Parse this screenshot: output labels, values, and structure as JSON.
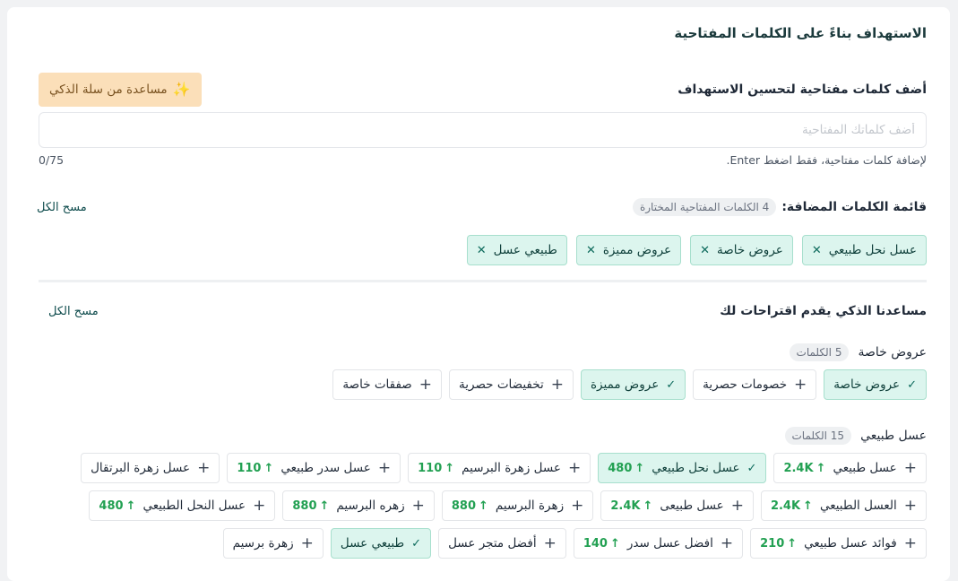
{
  "section_title": "الاستهداف بناءً على الكلمات المفتاحية",
  "keywords": {
    "label": "أضف كلمات مفتاحية لتحسين الاستهداف",
    "ai_button_label": "مساعدة من سلة الذكي",
    "ai_button_icon": "sparkles-icon",
    "input_placeholder": "أضف كلماتك المفتاحية",
    "input_value": "",
    "helper_text": "لإضافة كلمات مفتاحية، فقط اضغط Enter.",
    "char_counter": "0/75"
  },
  "added_list": {
    "label": "قائمة الكلمات المضافة:",
    "count_badge": "4 الكلمات المفتاحية المختارة",
    "clear_label": "مسح الكل",
    "chips": [
      {
        "label": "عسل نحل طبيعي"
      },
      {
        "label": "عروض خاصة"
      },
      {
        "label": "عروض مميزة"
      },
      {
        "label": "طبيعي عسل"
      }
    ]
  },
  "suggestions": {
    "label": "مساعدنا الذكي يقدم اقتراحات لك",
    "clear_label": "مسح الكل",
    "groups": [
      {
        "name": "عروض خاصة",
        "count_badge": "5 الكلمات",
        "chips": [
          {
            "label": "عروض خاصة",
            "selected": true,
            "stat": ""
          },
          {
            "label": "خصومات حصرية",
            "selected": false,
            "stat": ""
          },
          {
            "label": "عروض مميزة",
            "selected": true,
            "stat": ""
          },
          {
            "label": "تخفيضات حصرية",
            "selected": false,
            "stat": ""
          },
          {
            "label": "صفقات خاصة",
            "selected": false,
            "stat": ""
          }
        ]
      },
      {
        "name": "عسل طبيعي",
        "count_badge": "15 الكلمات",
        "chips": [
          {
            "label": "عسل طبيعي",
            "selected": false,
            "stat": "2.4K"
          },
          {
            "label": "عسل نحل طبيعي",
            "selected": true,
            "stat": "480"
          },
          {
            "label": "عسل زهرة البرسيم",
            "selected": false,
            "stat": "110"
          },
          {
            "label": "عسل سدر طبيعي",
            "selected": false,
            "stat": "110"
          },
          {
            "label": "عسل زهرة البرتقال",
            "selected": false,
            "stat": ""
          },
          {
            "label": "العسل الطبيعي",
            "selected": false,
            "stat": "2.4K"
          },
          {
            "label": "عسل طبيعى",
            "selected": false,
            "stat": "2.4K"
          },
          {
            "label": "زهرة البرسيم",
            "selected": false,
            "stat": "880"
          },
          {
            "label": "زهره البرسيم",
            "selected": false,
            "stat": "880"
          },
          {
            "label": "عسل النحل الطبيعي",
            "selected": false,
            "stat": "480"
          },
          {
            "label": "فوائد عسل طبيعي",
            "selected": false,
            "stat": "210"
          },
          {
            "label": "افضل عسل سدر",
            "selected": false,
            "stat": "140"
          },
          {
            "label": "أفضل متجر عسل",
            "selected": false,
            "stat": ""
          },
          {
            "label": "طبيعي عسل",
            "selected": true,
            "stat": ""
          },
          {
            "label": "زهرة برسيم",
            "selected": false,
            "stat": ""
          }
        ]
      }
    ]
  },
  "colors": {
    "accent": "#0f4c4d",
    "selected_bg": "#dcf5ee",
    "ai_button_bg": "#fbdfb9",
    "stat_green": "#22a052"
  }
}
